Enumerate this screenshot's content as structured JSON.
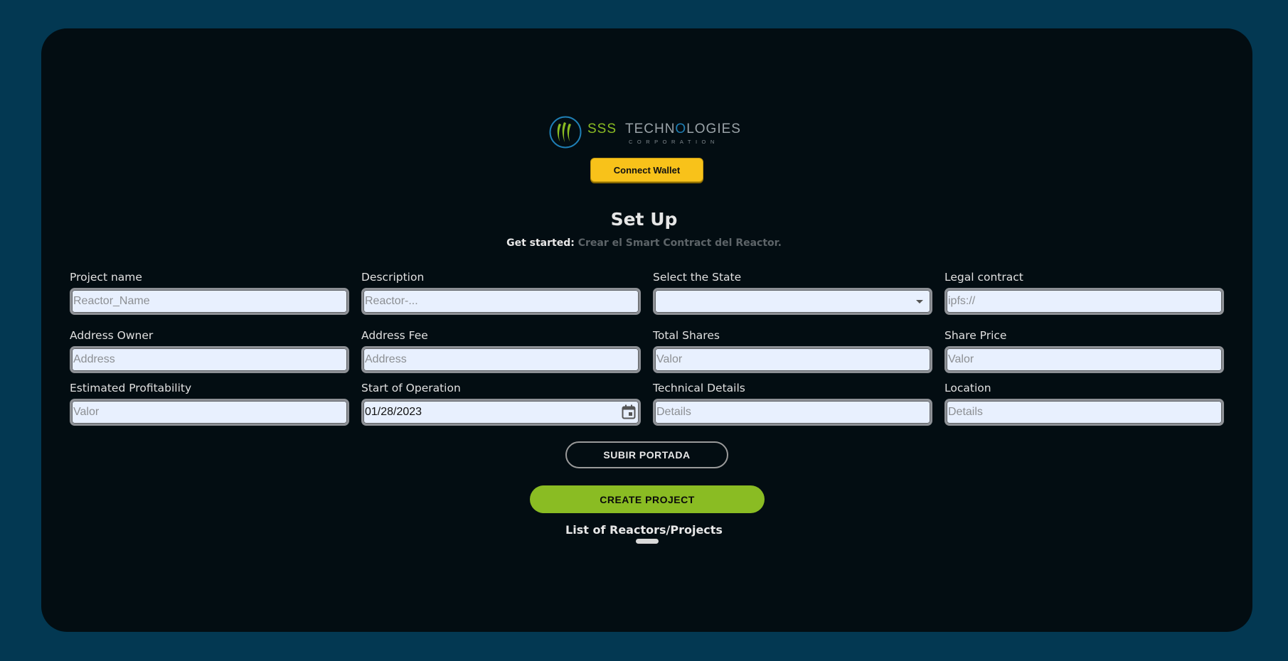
{
  "logo": {
    "brand": "SSS",
    "name_part1": "TECHN",
    "name_o": "O",
    "name_part2": "LOGIES",
    "tagline": "CORPORATION",
    "icon": "sss-flame-logo-icon"
  },
  "header": {
    "connect_label": "Connect Wallet"
  },
  "setup": {
    "title": "Set Up",
    "subtitle_lead": "Get started:",
    "subtitle_rest": "Crear el Smart Contract del Reactor."
  },
  "fields": {
    "project_name": {
      "label": "Project name",
      "placeholder": "Reactor_Name"
    },
    "description": {
      "label": "Description",
      "placeholder": "Reactor-..."
    },
    "state": {
      "label": "Select the State",
      "value": ""
    },
    "legal_contract": {
      "label": "Legal contract",
      "placeholder": "ipfs://"
    },
    "address_owner": {
      "label": "Address Owner",
      "placeholder": "Address"
    },
    "address_fee": {
      "label": "Address Fee",
      "placeholder": "Address"
    },
    "total_shares": {
      "label": "Total Shares",
      "placeholder": "Valor"
    },
    "share_price": {
      "label": "Share Price",
      "placeholder": "Valor"
    },
    "estimated_profitability": {
      "label": "Estimated Profitability",
      "placeholder": "Valor"
    },
    "start_of_operation": {
      "label": "Start of Operation",
      "value": "01/28/2023"
    },
    "technical_details": {
      "label": "Technical Details",
      "placeholder": "Details"
    },
    "location": {
      "label": "Location",
      "placeholder": "Details"
    }
  },
  "actions": {
    "upload_cover_label": "SUBIR PORTADA",
    "create_project_label": "CREATE PROJECT"
  },
  "list": {
    "title": "List of Reactors/Projects"
  },
  "colors": {
    "page_bg": "#033852",
    "card_bg": "#030d12",
    "accent_green": "#8abc23",
    "accent_yellow": "#f8c21a",
    "logo_blue": "#1f7fb5"
  }
}
